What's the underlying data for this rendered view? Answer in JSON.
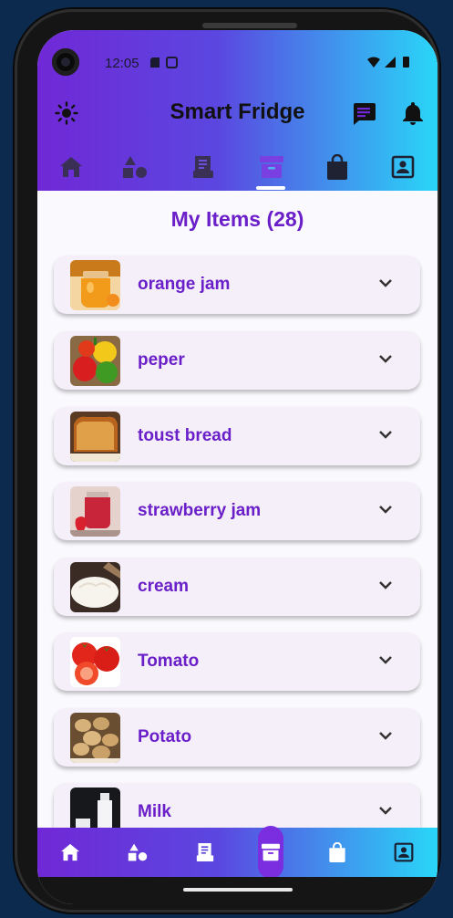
{
  "status_bar": {
    "time": "12:05"
  },
  "app": {
    "title": "Smart Fridge"
  },
  "colors": {
    "accent": "#6a1fc9",
    "gradient_start": "#7028d6",
    "gradient_end": "#29d6f8"
  },
  "top_tabs": [
    {
      "icon": "home-icon",
      "active": false
    },
    {
      "icon": "categories-icon",
      "active": false
    },
    {
      "icon": "receipt-icon",
      "active": false
    },
    {
      "icon": "archive-box-icon",
      "active": true
    },
    {
      "icon": "shopping-bag-icon",
      "active": false
    },
    {
      "icon": "profile-icon",
      "active": false
    }
  ],
  "main": {
    "section_title": "My Items (28)",
    "items": [
      {
        "label": "orange jam",
        "thumb": "orange-jam-image"
      },
      {
        "label": "peper",
        "thumb": "peppers-image"
      },
      {
        "label": "toust bread",
        "thumb": "toast-bread-image"
      },
      {
        "label": "strawberry jam",
        "thumb": "strawberry-jam-image"
      },
      {
        "label": "cream",
        "thumb": "cream-image"
      },
      {
        "label": "Tomato",
        "thumb": "tomato-image"
      },
      {
        "label": "Potato",
        "thumb": "potato-image"
      },
      {
        "label": "Milk",
        "thumb": "milk-image"
      }
    ]
  },
  "bottom_nav": [
    {
      "icon": "home-icon",
      "active": false
    },
    {
      "icon": "categories-icon",
      "active": false
    },
    {
      "icon": "receipt-icon",
      "active": false
    },
    {
      "icon": "archive-box-icon",
      "active": true
    },
    {
      "icon": "shopping-bag-icon",
      "active": false
    },
    {
      "icon": "profile-icon",
      "active": false
    }
  ]
}
